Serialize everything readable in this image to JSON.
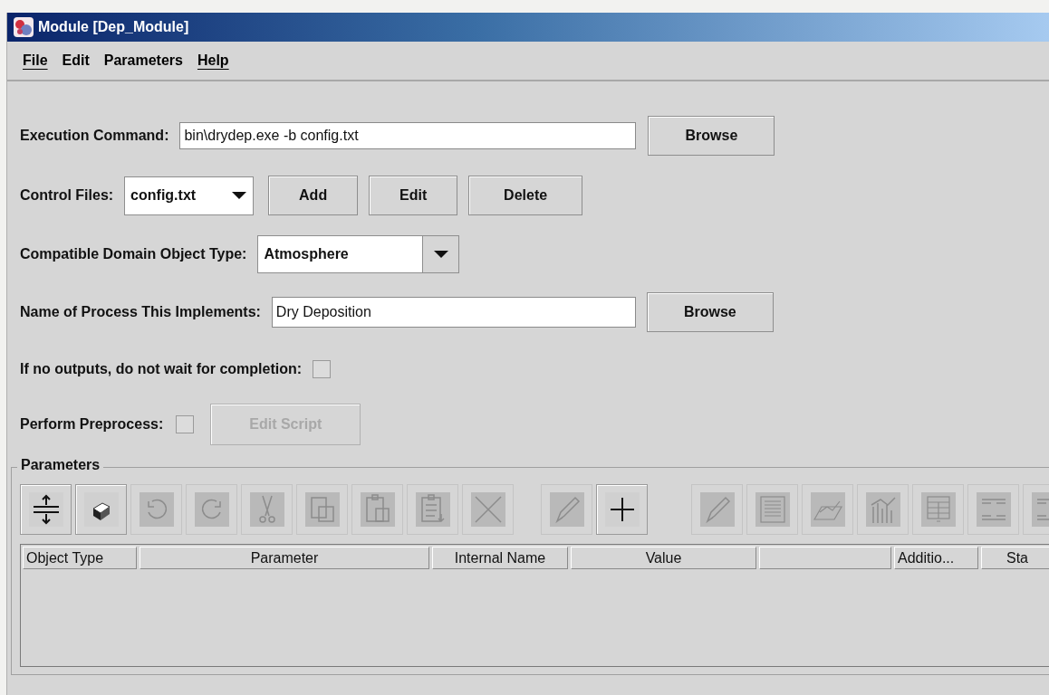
{
  "window": {
    "title": "Module [Dep_Module]"
  },
  "menu": [
    {
      "label": "File",
      "mnemonic": true
    },
    {
      "label": "Edit",
      "mnemonic": false
    },
    {
      "label": "Parameters",
      "mnemonic": false
    },
    {
      "label": "Help",
      "mnemonic": true
    }
  ],
  "execution_command": {
    "label": "Execution Command:",
    "value": "bin\\drydep.exe -b config.txt",
    "button": "Browse"
  },
  "control_files": {
    "label": "Control Files:",
    "value": "config.txt",
    "buttons": [
      "Add",
      "Edit",
      "Delete"
    ]
  },
  "domain_object_type": {
    "label": "Compatible Domain Object Type:",
    "value": "Atmosphere"
  },
  "process_name": {
    "label": "Name of Process This Implements:",
    "value": "Dry Deposition",
    "button": "Browse"
  },
  "no_wait": {
    "label": "If no outputs, do not wait for completion:",
    "checked": false
  },
  "preprocess": {
    "label": "Perform Preprocess:",
    "checked": false,
    "button": "Edit Script",
    "button_disabled": true
  },
  "parameters": {
    "title": "Parameters",
    "toolbar": [
      [
        {
          "disabled": false
        },
        {
          "disabled": false
        },
        {
          "disabled": true
        },
        {
          "disabled": true
        },
        {
          "disabled": true
        },
        {
          "disabled": true
        },
        {
          "disabled": true
        },
        {
          "disabled": true
        },
        {
          "disabled": true
        }
      ],
      [
        {
          "disabled": true
        },
        {
          "disabled": false
        }
      ],
      [
        {
          "disabled": true
        },
        {
          "disabled": true
        },
        {
          "disabled": true
        },
        {
          "disabled": true
        },
        {
          "disabled": true
        },
        {
          "disabled": true
        },
        {
          "disabled": true
        }
      ]
    ],
    "columns": [
      {
        "kind": "text",
        "label": "Object Type"
      },
      {
        "kind": "text",
        "label": "Parameter"
      },
      {
        "kind": "text",
        "label": "Internal Name"
      },
      {
        "kind": "text",
        "label": "Value"
      },
      {
        "kind": "empty"
      },
      {
        "kind": "text",
        "label": "Additio..."
      },
      {
        "kind": "text",
        "label": "Sta"
      }
    ]
  }
}
